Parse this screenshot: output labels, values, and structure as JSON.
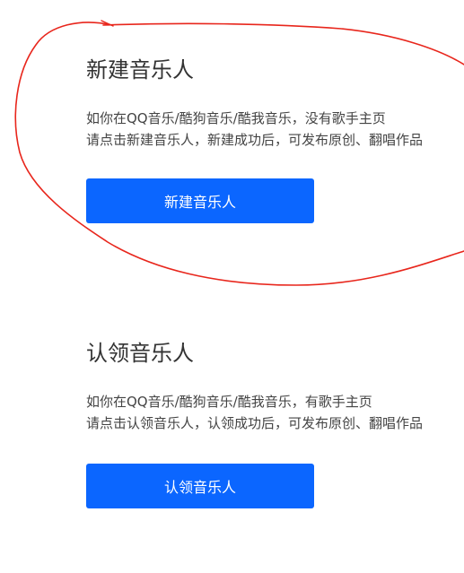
{
  "create": {
    "title": "新建音乐人",
    "line1": "如你在QQ音乐/酷狗音乐/酷我音乐，没有歌手主页",
    "line2": "请点击新建音乐人，新建成功后，可发布原创、翻唱作品",
    "button_label": "新建音乐人"
  },
  "claim": {
    "title": "认领音乐人",
    "line1": "如你在QQ音乐/酷狗音乐/酷我音乐，有歌手主页",
    "line2": "请点击认领音乐人，认领成功后，可发布原创、翻唱作品",
    "button_label": "认领音乐人"
  },
  "colors": {
    "primary_button": "#0b66ff",
    "annotation_stroke": "#e8261c",
    "title_text": "#333333",
    "body_text": "#444444"
  }
}
